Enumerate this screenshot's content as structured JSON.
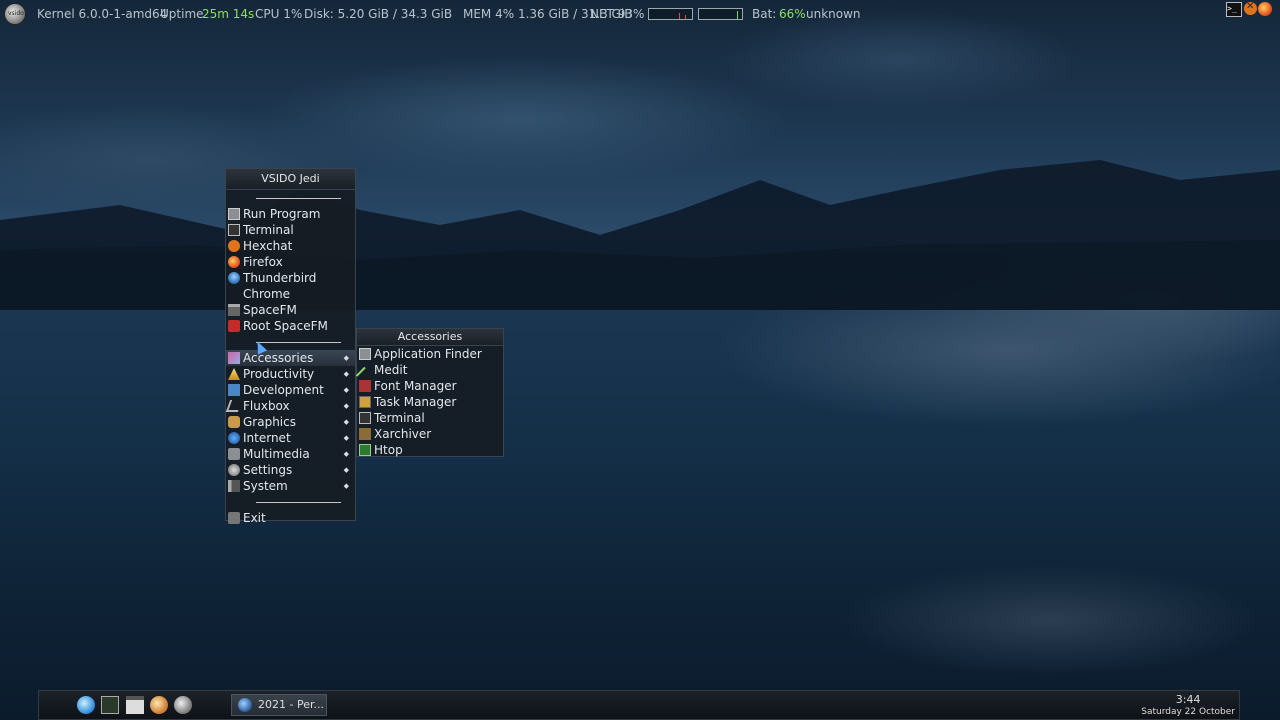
{
  "conky": {
    "logo_label": "vsido",
    "kernel": "Kernel 6.0.0-1-amd64",
    "uptime_label": "Uptime",
    "uptime_value": "25m 14s",
    "cpu": "CPU 1%",
    "disk": "Disk: 5.20 GiB / 34.3 GiB",
    "mem": "MEM 4% 1.36 GiB / 31.3 GiB",
    "net": "NET 93%",
    "bat_label": "Bat:",
    "bat_value": "66%",
    "bat_status": "unknown"
  },
  "tray": {
    "terminal_glyph": ">_"
  },
  "main_menu": {
    "title": "VSIDO Jedi",
    "apps": [
      {
        "label": "Run Program",
        "icon": "run-icon"
      },
      {
        "label": "Terminal",
        "icon": "terminal-icon"
      },
      {
        "label": "Hexchat",
        "icon": "hexchat-icon"
      },
      {
        "label": "Firefox",
        "icon": "firefox-icon"
      },
      {
        "label": "Thunderbird",
        "icon": "thunderbird-icon"
      },
      {
        "label": "Chrome",
        "icon": ""
      },
      {
        "label": "SpaceFM",
        "icon": "spacefm-icon"
      },
      {
        "label": "Root SpaceFM",
        "icon": "root-spacefm-icon"
      }
    ],
    "categories": [
      {
        "label": "Accessories",
        "icon": "accessories-icon"
      },
      {
        "label": "Productivity",
        "icon": "productivity-icon"
      },
      {
        "label": "Development",
        "icon": "development-icon"
      },
      {
        "label": "Fluxbox",
        "icon": "fluxbox-icon"
      },
      {
        "label": "Graphics",
        "icon": "graphics-icon"
      },
      {
        "label": "Internet",
        "icon": "internet-icon"
      },
      {
        "label": "Multimedia",
        "icon": "multimedia-icon"
      },
      {
        "label": "Settings",
        "icon": "settings-icon"
      },
      {
        "label": "System",
        "icon": "system-icon"
      }
    ],
    "exit": "Exit"
  },
  "submenu": {
    "title": "Accessories",
    "items": [
      {
        "label": "Application Finder",
        "icon": "app-finder-icon"
      },
      {
        "label": "Medit",
        "icon": "medit-icon"
      },
      {
        "label": "Font Manager",
        "icon": "font-manager-icon"
      },
      {
        "label": "Task Manager",
        "icon": "task-manager-icon"
      },
      {
        "label": "Terminal",
        "icon": "terminal-icon"
      },
      {
        "label": "Xarchiver",
        "icon": "xarchiver-icon"
      },
      {
        "label": "Htop",
        "icon": "htop-icon"
      }
    ]
  },
  "panel": {
    "taskbar_item": "2021 - Per...",
    "clock_time": "3:44",
    "clock_date": "Saturday 22 October"
  },
  "colors": {
    "accent_green": "#8ee05c",
    "menu_bg": "#161c24"
  }
}
